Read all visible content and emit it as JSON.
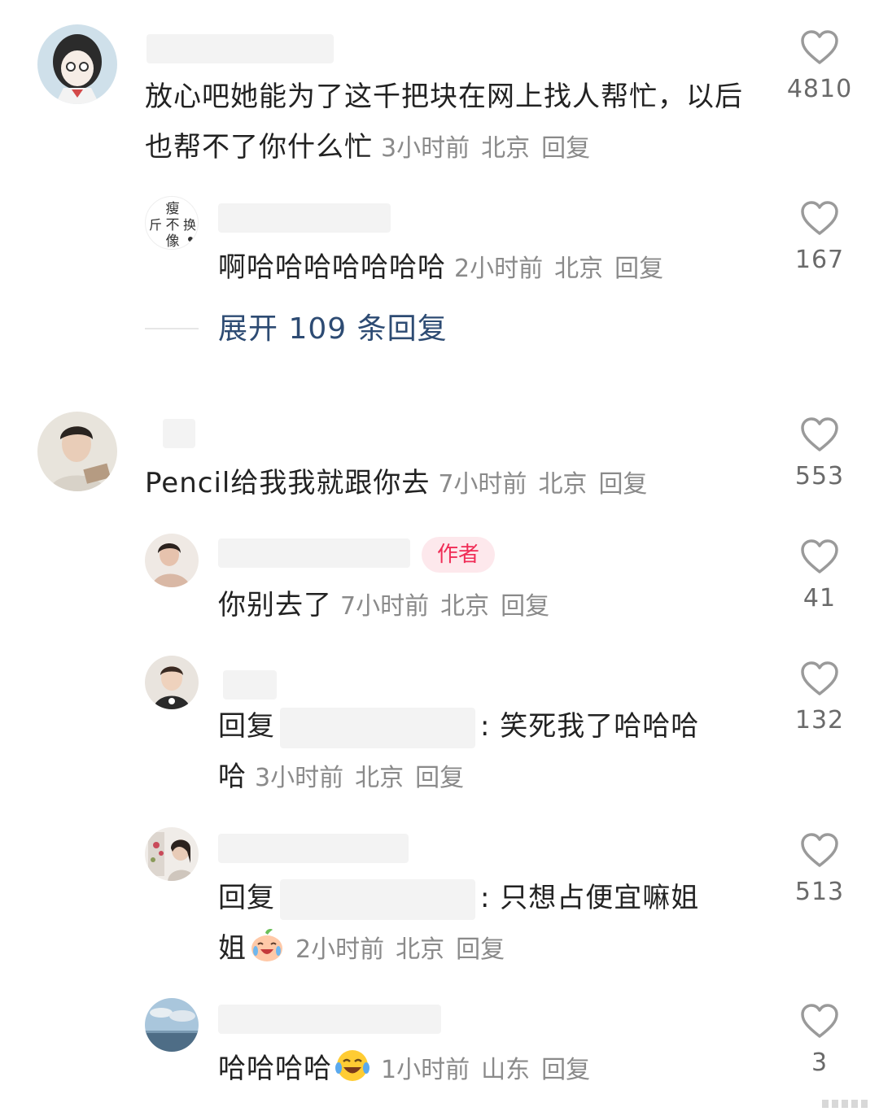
{
  "comments": [
    {
      "text": "放心吧她能为了这千把块在网上找人帮忙，以后也帮不了你什么忙",
      "time": "3小时前",
      "location": "北京",
      "reply_label": "回复",
      "likes": "4810",
      "avatar_icon": "anime-girl-avatar-icon",
      "replies": [
        {
          "text": "啊哈哈哈哈哈哈哈",
          "time": "2小时前",
          "location": "北京",
          "reply_label": "回复",
          "likes": "167",
          "avatar_icon": "text-grid-avatar-icon",
          "avatar_chars": [
            "瘦",
            "斤",
            "不",
            "换",
            "像"
          ]
        }
      ],
      "expand_label": "展开 109 条回复"
    },
    {
      "text": "Pencil给我我就跟你去",
      "time": "7小时前",
      "location": "北京",
      "reply_label": "回复",
      "likes": "553",
      "avatar_icon": "young-man-avatar-icon",
      "replies": [
        {
          "badge": "作者",
          "text": "你别去了",
          "time": "7小时前",
          "location": "北京",
          "reply_label": "回复",
          "likes": "41",
          "avatar_icon": "woman-avatar-icon"
        },
        {
          "reply_prefix": "回复",
          "text_after": ": 笑死我了哈哈哈",
          "text_wrap": "哈",
          "time": "3小时前",
          "location": "北京",
          "reply_label": "回复",
          "likes": "132",
          "avatar_icon": "child-avatar-icon"
        },
        {
          "reply_prefix": "回复",
          "text_after": ": 只想占便宜嘛姐",
          "text_wrap": "姐",
          "emoji": "crying-laughing-peach-emoji-icon",
          "time": "2小时前",
          "location": "北京",
          "reply_label": "回复",
          "likes": "513",
          "avatar_icon": "flowers-woman-avatar-icon"
        },
        {
          "text": "哈哈哈哈",
          "emoji": "tears-of-joy-emoji-icon",
          "time": "1小时前",
          "location": "山东",
          "reply_label": "回复",
          "likes": "3",
          "avatar_icon": "sea-sky-avatar-icon"
        }
      ]
    }
  ],
  "colors": {
    "author_badge_bg": "#fde8ec",
    "author_badge_text": "#f02c56",
    "expand_link": "#2d4b73",
    "meta_gray": "#8a8a8a"
  }
}
